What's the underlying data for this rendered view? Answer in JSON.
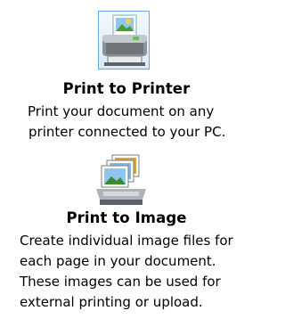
{
  "options": [
    {
      "title": "Print to Printer",
      "description_lines": [
        "Print your document on any",
        "printer connected to your PC."
      ],
      "icon": "printer-icon",
      "selected": true
    },
    {
      "title": "Print to Image",
      "description_lines": [
        "Create individual image files for",
        "each page in your document.",
        "These images can be used for",
        "external printing or upload."
      ],
      "icon": "image-stack-icon",
      "selected": false
    }
  ],
  "colors": {
    "selection_border": "#66a7e8",
    "selection_fill": "#dbeafb",
    "text": "#000000",
    "background": "#ffffff"
  }
}
